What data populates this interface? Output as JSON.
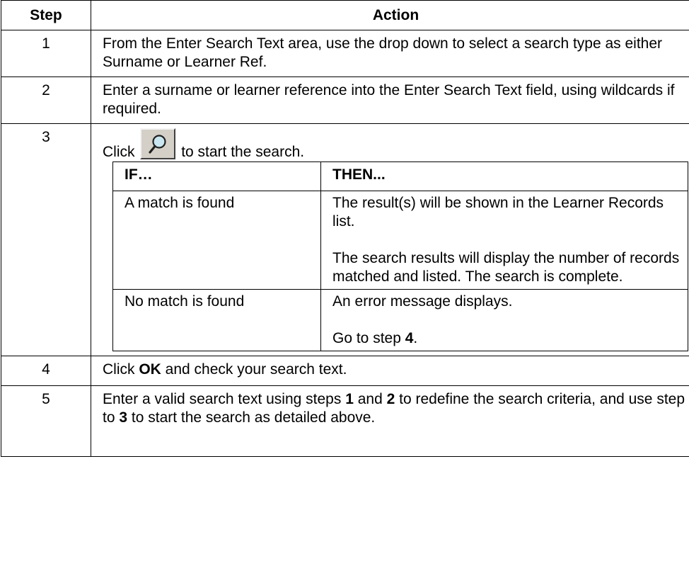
{
  "table": {
    "header_step": "Step",
    "header_action": "Action",
    "rows": [
      {
        "step": "1",
        "text": "From the Enter Search Text area, use the drop down to select a search type as either Surname or Learner Ref."
      },
      {
        "step": "2",
        "text": "Enter a surname or learner reference into the Enter Search Text field, using wildcards if required."
      },
      {
        "step": "3",
        "click_before": "Click",
        "click_after": "to start the search."
      },
      {
        "step": "4",
        "pre": "Click ",
        "bold": "OK",
        "post": " and check your search text."
      },
      {
        "step": "5",
        "a": "Enter a valid search text using steps ",
        "b1": "1",
        "c": " and ",
        "b2": "2",
        "d": " to redefine the search criteria, and use step to ",
        "b3": "3",
        "e": " to start the search as detailed above."
      }
    ]
  },
  "inner_table": {
    "header_if": "IF…",
    "header_then": "THEN...",
    "row1_if": "A match is found",
    "row1_then_p1": "The result(s) will be shown in the Learner Records list.",
    "row1_then_p2": "The search results will display the number of records matched and listed. The search is complete.",
    "row2_if": "No match is found",
    "row2_then_p1": "An error message displays.",
    "row2_then_p2_pre": "Go to step ",
    "row2_then_p2_bold": "4",
    "row2_then_p2_post": "."
  },
  "icons": {
    "search_button": "magnifier-search-icon"
  },
  "colors": {
    "button_face": "#d4d0c8",
    "lens_tint": "#c9e6f0"
  }
}
